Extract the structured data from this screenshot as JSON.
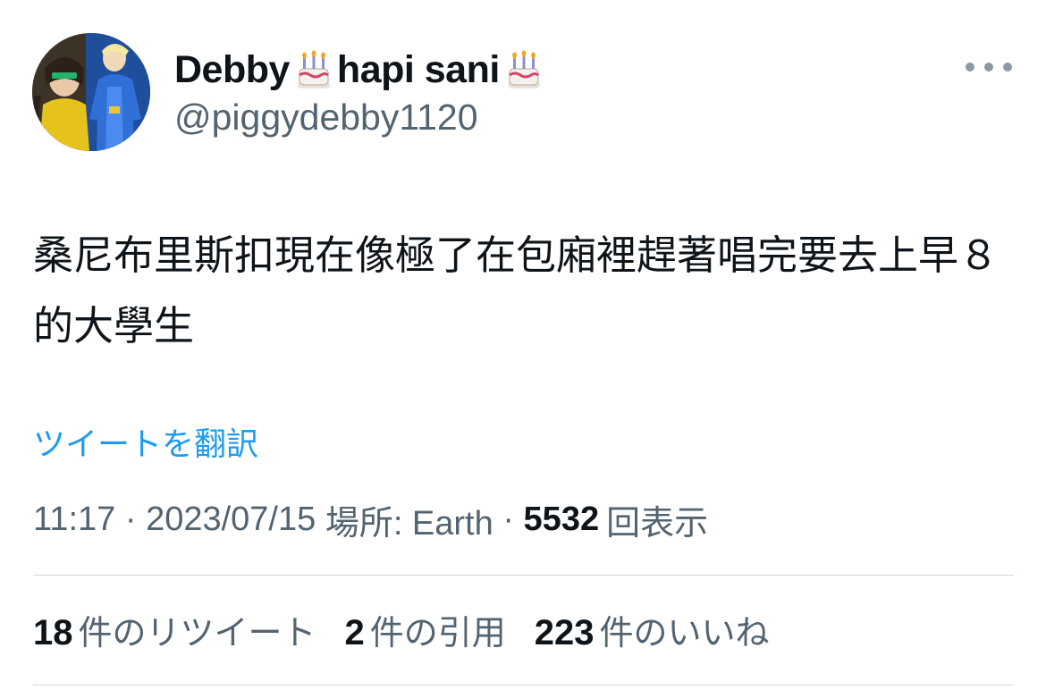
{
  "user": {
    "display_name_part1": "Debby",
    "display_name_part2": "hapi sani",
    "display_name_emoji": "birthday-cake-emoji",
    "handle": "@piggydebby1120"
  },
  "tweet": {
    "text": "桑尼布里斯扣現在像極了在包廂裡趕著唱完要去上早８的大學生",
    "translate_label": "ツイートを翻訳"
  },
  "meta": {
    "time": "11:17",
    "separator": "·",
    "date": "2023/07/15",
    "location_label": "場所: Earth",
    "views_count": "5532",
    "views_label": "回表示"
  },
  "stats": {
    "retweets_count": "18",
    "retweets_label": "件のリツイート",
    "quotes_count": "2",
    "quotes_label": "件の引用",
    "likes_count": "223",
    "likes_label": "件のいいね"
  },
  "icons": {
    "more": "more-horizontal-icon",
    "avatar": "user-avatar"
  },
  "colors": {
    "link": "#1d9bf0",
    "secondary_text": "#536471",
    "primary_text": "#0f1419",
    "divider": "#cfd9de"
  }
}
